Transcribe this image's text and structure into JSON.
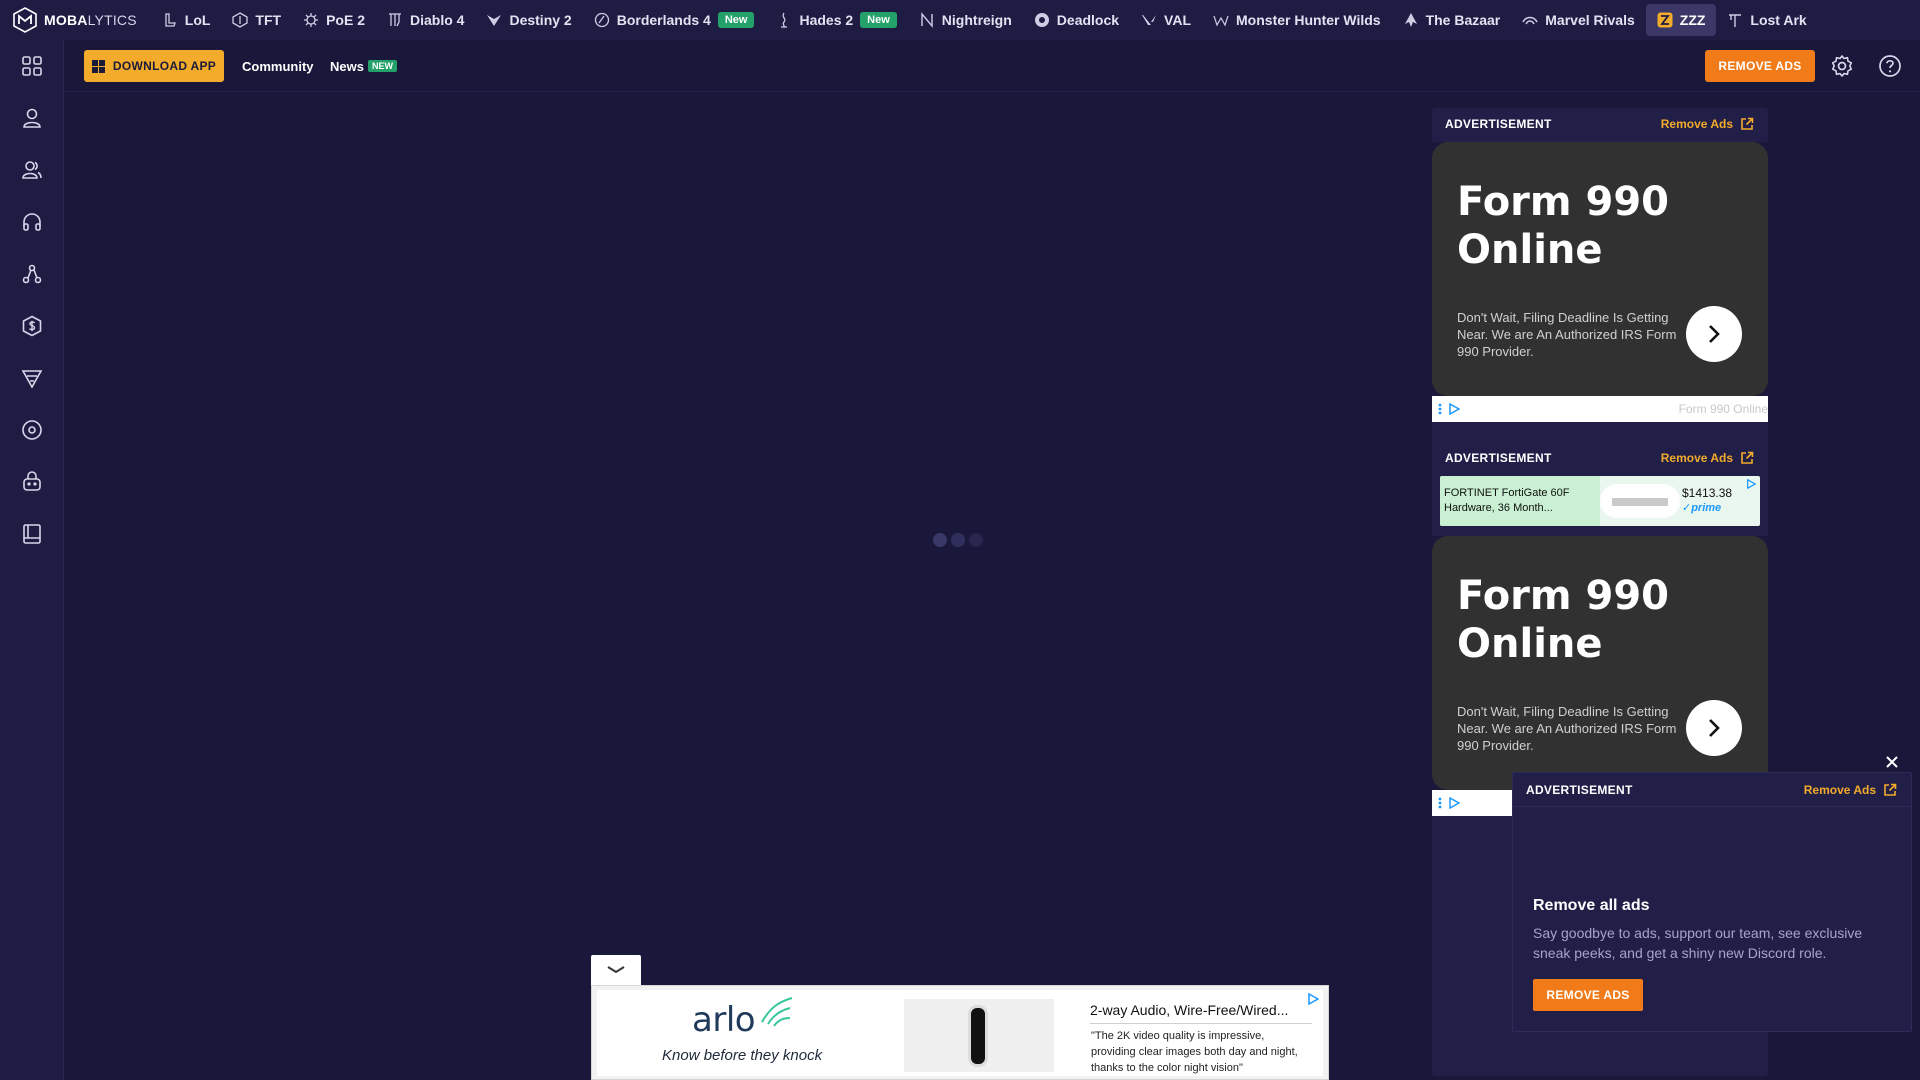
{
  "brand": {
    "logo_bold": "MOBA",
    "logo_thin": "LYTICS"
  },
  "games": [
    {
      "label": "LoL",
      "icon": "lol-icon"
    },
    {
      "label": "TFT",
      "icon": "tft-icon"
    },
    {
      "label": "PoE 2",
      "icon": "poe2-icon"
    },
    {
      "label": "Diablo 4",
      "icon": "diablo4-icon"
    },
    {
      "label": "Destiny 2",
      "icon": "destiny2-icon"
    },
    {
      "label": "Borderlands 4",
      "icon": "borderlands4-icon",
      "badge": "New"
    },
    {
      "label": "Hades 2",
      "icon": "hades2-icon",
      "badge": "New"
    },
    {
      "label": "Nightreign",
      "icon": "nightreign-icon"
    },
    {
      "label": "Deadlock",
      "icon": "deadlock-icon"
    },
    {
      "label": "VAL",
      "icon": "valorant-icon"
    },
    {
      "label": "Monster Hunter Wilds",
      "icon": "monster-hunter-icon"
    },
    {
      "label": "The Bazaar",
      "icon": "bazaar-icon"
    },
    {
      "label": "Marvel Rivals",
      "icon": "marvel-rivals-icon"
    },
    {
      "label": "ZZZ",
      "icon": "zzz-icon",
      "active": true
    },
    {
      "label": "Lost Ark",
      "icon": "lost-ark-icon"
    }
  ],
  "sidebar_icons": [
    "grid-icon",
    "user-icon",
    "users-icon",
    "headphones-icon",
    "route-icon",
    "coin-icon",
    "tier-icon",
    "disc-icon",
    "bot-icon",
    "book-icon"
  ],
  "header": {
    "download_label": "DOWNLOAD APP",
    "community_label": "Community",
    "news_label": "News",
    "news_badge": "NEW",
    "remove_ads_label": "REMOVE ADS"
  },
  "ads": {
    "advertisement_label": "ADVERTISEMENT",
    "remove_ads_link": "Remove Ads",
    "form990": {
      "title": "Form 990 Online",
      "text": "Don't Wait, Filing Deadline Is Getting Near. We are An Authorized IRS Form 990 Provider.",
      "sponsor": "Form 990 Online"
    },
    "prime": {
      "product_name": "FORTINET FortiGate 60F Hardware, 36 Month...",
      "price": "$1413.38",
      "badge": "✓prime"
    },
    "arlo": {
      "logo": "arlo",
      "tagline": "Know before they knock",
      "headline": "2-way Audio, Wire-Free/Wired...",
      "quote": "\"The 2K video quality is impressive, providing clear images both day and night, thanks to the color night vision\""
    }
  },
  "promo": {
    "advertisement_label": "ADVERTISEMENT",
    "remove_ads_link": "Remove Ads",
    "title": "Remove all ads",
    "text": "Say goodbye to ads, support our team, see exclusive sneak peeks, and get a shiny new Discord role.",
    "button": "REMOVE ADS"
  },
  "colors": {
    "background": "#19173a",
    "bar": "#1e1c43",
    "accent_yellow": "#f2ab2b",
    "accent_orange": "#f07b18",
    "badge_green": "#24a16a"
  }
}
